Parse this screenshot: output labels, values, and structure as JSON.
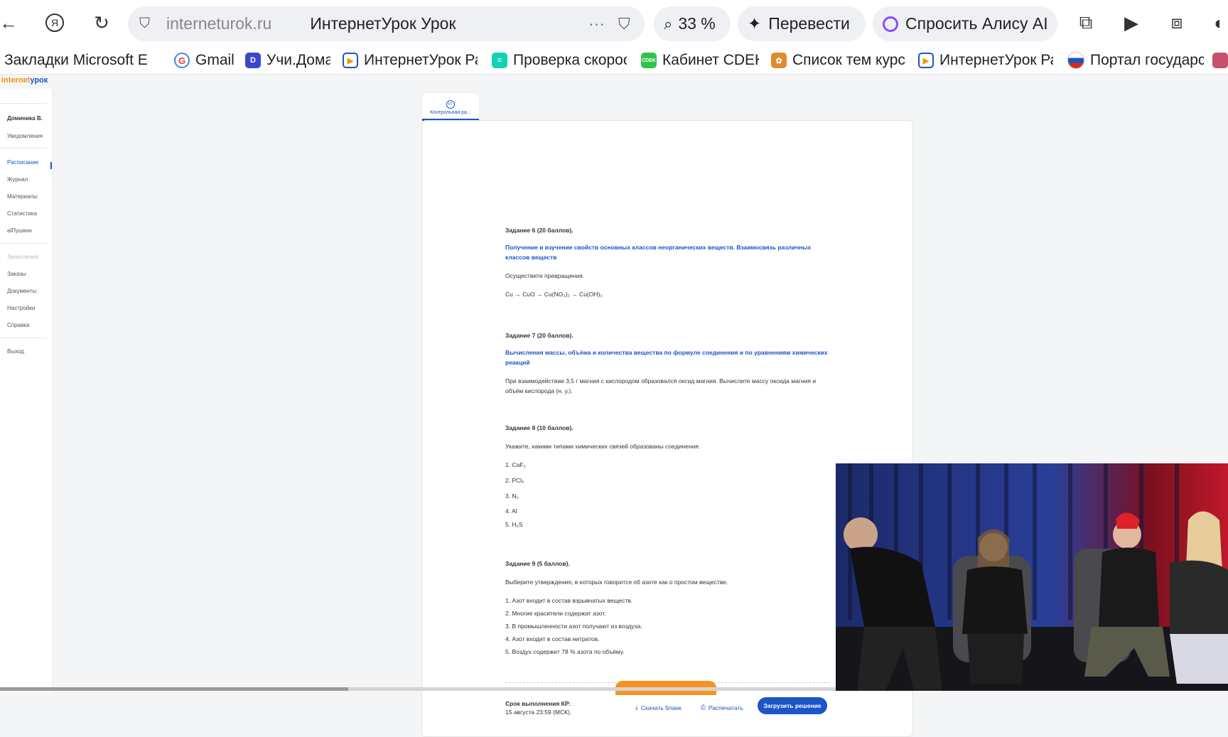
{
  "browser": {
    "address_domain": "interneturok.ru",
    "page_title": "ИнтернетУрок Урок",
    "zoom": "33 %",
    "translate_label": "Перевести",
    "alice_label": "Спросить Алису AI"
  },
  "bookmarks": [
    {
      "label": "Закладки Microsoft E",
      "color": "#ffffff"
    },
    {
      "label": "Gmail",
      "color": "#ea4335"
    },
    {
      "label": "Учи.Дома",
      "color": "#3b47c6"
    },
    {
      "label": "ИнтернетУрок Ра",
      "color": "#1a56c5"
    },
    {
      "label": "Проверка скорос",
      "color": "#14d1b0"
    },
    {
      "label": "Кабинет CDEK",
      "color": "#2fc34a"
    },
    {
      "label": "Список тем курса",
      "color": "#e08a2a"
    },
    {
      "label": "ИнтернетУрок Ра",
      "color": "#1a56c5"
    },
    {
      "label": "Портал государст",
      "color": "#d52b1e"
    }
  ],
  "site": {
    "logo_part1": "internet",
    "logo_part2": "урок"
  },
  "sidebar": {
    "user": "Доминика В.",
    "notifications": "Уведомления",
    "items": [
      "Расписание",
      "Журнал",
      "Материалы",
      "Статистика",
      "aiПушкин"
    ],
    "items2": [
      "Зачисления",
      "Заказы",
      "Документы",
      "Настройки",
      "Справка"
    ],
    "logout": "Выход"
  },
  "tab": {
    "label": "Контрольная ра...",
    "icon": "КТ"
  },
  "tasks": {
    "t6_title": "Задание 6 (20 баллов).",
    "t6_topic": "Получение и изучение свойств основных классов неорганических веществ. Взаимосвязь различных классов веществ",
    "t6_text": "Осуществите превращения.",
    "t6_formula": "Cu → CuO → Cu(NO₃)₂ → Cu(OH)₂",
    "t7_title": "Задание 7 (20 баллов).",
    "t7_topic": "Вычисления массы, объёма и количества вещества по формуле соединения и по уравнениям химических реакций",
    "t7_text": "При взаимодействии 3,5 г магния с кислородом образовался оксид магния. Вычислите массу оксида магния и объём кислорода (н. у.).",
    "t8_title": "Задание 8 (10 баллов).",
    "t8_text": "Укажите, какими типами химических связей образованы соединения.",
    "t8_items": [
      "1. CaF₂",
      "2. PCl₅",
      "3. N₂",
      "4. Al",
      "5. H₂S"
    ],
    "t9_title": "Задание 9 (5 баллов).",
    "t9_text": "Выберите утверждения, в которых говорится об азоте как о простом веществе.",
    "t9_items": [
      "1. Азот входит в состав взрывчатых веществ.",
      "2. Многие красители содержат азот.",
      "3. В промышленности азот получают из воздуха.",
      "4. Азот входит в состав нитратов.",
      "5. Воздух содержит 78 % азота по объёму."
    ]
  },
  "footer": {
    "deadline_label": "Срок выполнения КР:",
    "deadline_value": "15 августа 23:59 (МСК).",
    "download": "Скачать бланк",
    "print": "Распечатать",
    "upload": "Загрузить решение"
  }
}
